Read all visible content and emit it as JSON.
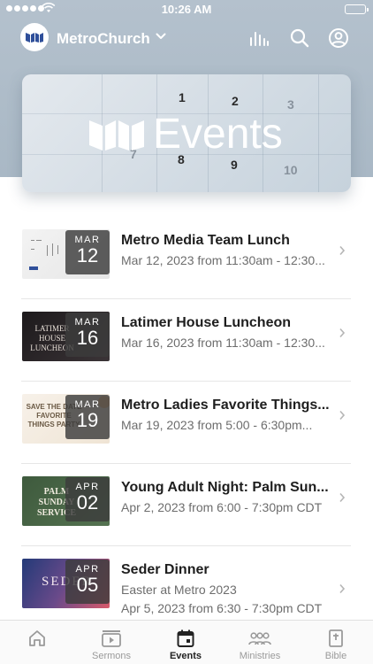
{
  "status_bar": {
    "time": "10:26 AM"
  },
  "header": {
    "church_name": "MetroChurch"
  },
  "banner": {
    "title": "Events",
    "calendar_numbers": [
      "1",
      "2",
      "3",
      "8",
      "9",
      "10",
      "7"
    ]
  },
  "events": [
    {
      "month": "MAR",
      "day": "12",
      "title": "Metro Media Team Lunch",
      "lines": [
        "Mar 12, 2023 from 11:30am - 12:30..."
      ],
      "thumb": {
        "colors": [
          "#f2f2f2",
          "#e8e8e8"
        ],
        "text": ""
      }
    },
    {
      "month": "MAR",
      "day": "16",
      "title": "Latimer House Luncheon",
      "lines": [
        "Mar 16, 2023 from 11:30am - 12:30..."
      ],
      "thumb": {
        "colors": [
          "#1d1a1c",
          "#3b3437"
        ],
        "text": "LATIMER HOUSE LUNCHEON"
      }
    },
    {
      "month": "MAR",
      "day": "19",
      "title": "Metro Ladies Favorite Things...",
      "lines": [
        "Mar 19, 2023 from 5:00 - 6:30pm..."
      ],
      "thumb": {
        "colors": [
          "#f7f1e9",
          "#efe4d4"
        ],
        "text": "SAVE THE DATE FAVORITE THINGS PARTY"
      }
    },
    {
      "month": "APR",
      "day": "02",
      "title": "Young Adult Night: Palm Sun...",
      "lines": [
        "Apr 2, 2023 from 6:00 - 7:30pm CDT"
      ],
      "thumb": {
        "colors": [
          "#3e5a3d",
          "#4f6d4b"
        ],
        "text": "PALM SUNDAY SERVICE"
      }
    },
    {
      "month": "APR",
      "day": "05",
      "title": "Seder Dinner",
      "lines": [
        "Easter at Metro 2023",
        "Apr 5, 2023 from 6:30 - 7:30pm CDT"
      ],
      "thumb": {
        "colors": [
          "#2a3f7a",
          "#c0507a"
        ],
        "text": "SEDER"
      }
    }
  ],
  "tabs": [
    {
      "label": "",
      "icon": "home-icon"
    },
    {
      "label": "Sermons",
      "icon": "sermons-icon"
    },
    {
      "label": "Events",
      "icon": "events-icon",
      "active": true
    },
    {
      "label": "Ministries",
      "icon": "ministries-icon"
    },
    {
      "label": "Bible",
      "icon": "bible-icon"
    }
  ],
  "colors": {
    "header_bg": "#b4c1cd",
    "text_dark": "#1e1e1e",
    "text_muted": "#6d6d6d",
    "tab_inactive": "#9a9a9a",
    "tab_active": "#222222"
  }
}
